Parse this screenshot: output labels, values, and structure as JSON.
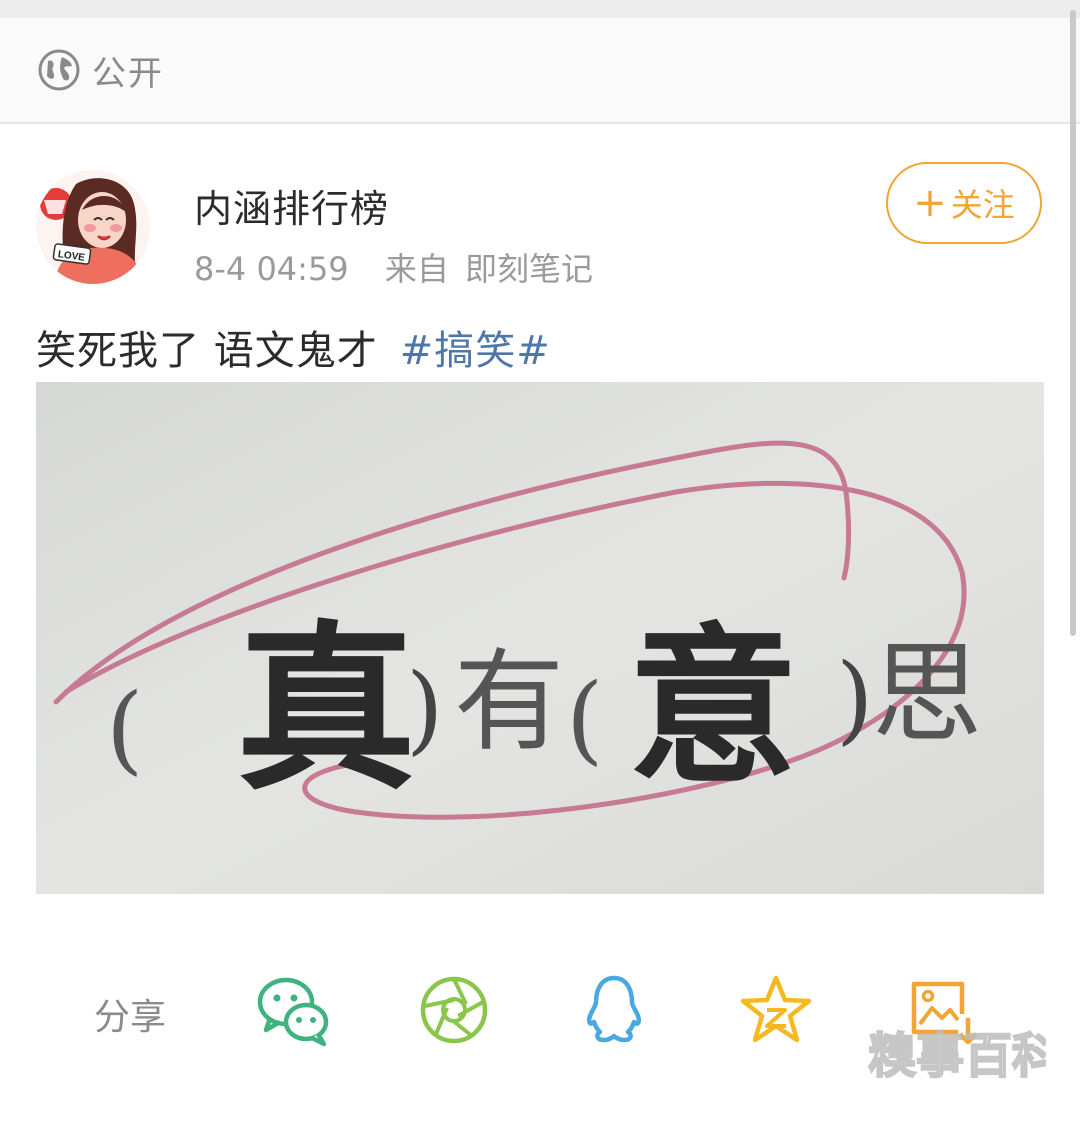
{
  "header": {
    "visibility_label": "公开",
    "visibility_icon": "globe-icon"
  },
  "post": {
    "author_name": "内涵排行榜",
    "avatar_badge": "LOVE",
    "timestamp": "8-4 04:59",
    "source_label": "来自",
    "source_app": "即刻笔记",
    "follow_label": "关注",
    "text": "笑死我了 语文鬼才",
    "hashtag": "#搞笑#",
    "image_text": {
      "open_1": "(",
      "answer_1": "真",
      "close_1": ")",
      "middle": "有",
      "open_2": "(",
      "answer_2": "意",
      "close_2": ")",
      "tail": "思"
    }
  },
  "share": {
    "label": "分享",
    "targets": [
      {
        "icon": "wechat-icon",
        "color": "#3fb37f"
      },
      {
        "icon": "moments-icon",
        "color": "#8ac64b"
      },
      {
        "icon": "qq-icon",
        "color": "#4aa8e0"
      },
      {
        "icon": "qzone-icon",
        "color": "#f5b820"
      },
      {
        "icon": "save-image-icon",
        "color": "#f0a534"
      }
    ]
  },
  "watermark": "糗事百科",
  "colors": {
    "accent_orange": "#f0a534",
    "hashtag_blue": "#4f76a8",
    "meta_gray": "#9a9a9a"
  }
}
